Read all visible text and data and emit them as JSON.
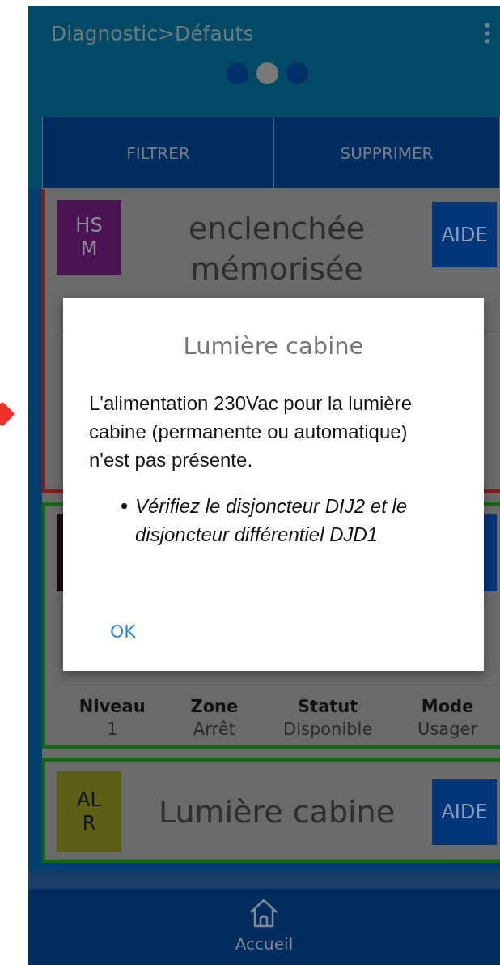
{
  "header": {
    "title": "Diagnostic>Défauts",
    "pages": [
      {
        "selected": false
      },
      {
        "selected": true
      },
      {
        "selected": false
      }
    ]
  },
  "actions": [
    "FILTRER",
    "SUPPRIMER"
  ],
  "cards": [
    {
      "color": "#8a1a1a",
      "badge": {
        "text": "HSM",
        "color": "#4a1452"
      },
      "title": "enclenchée mémorisée",
      "help": "AIDE"
    },
    {
      "color": "#0f6a12",
      "badge": {
        "color": "#1a0c0c"
      },
      "footer": [
        {
          "label": "Niveau",
          "value": "1"
        },
        {
          "label": "Zone",
          "value": "Arrêt"
        },
        {
          "label": "Statut",
          "value": "Disponible"
        },
        {
          "label": "Mode",
          "value": "Usager"
        }
      ]
    },
    {
      "color": "#0f6a12",
      "badge": {
        "text": "ALR",
        "color": "#5c6014"
      },
      "title": "Lumière cabine",
      "help": "AIDE"
    }
  ],
  "dialog": {
    "title": "Lumière cabine",
    "message": "L'alimentation 230Vac pour la lumière cabine (permanente ou automatique) n'est pas présente.",
    "bullets": [
      "Vérifiez le disjoncteur DIJ2 et le disjoncteur différentiel DJD1"
    ],
    "button": "OK"
  },
  "bottom_nav": {
    "label": "Accueil"
  }
}
